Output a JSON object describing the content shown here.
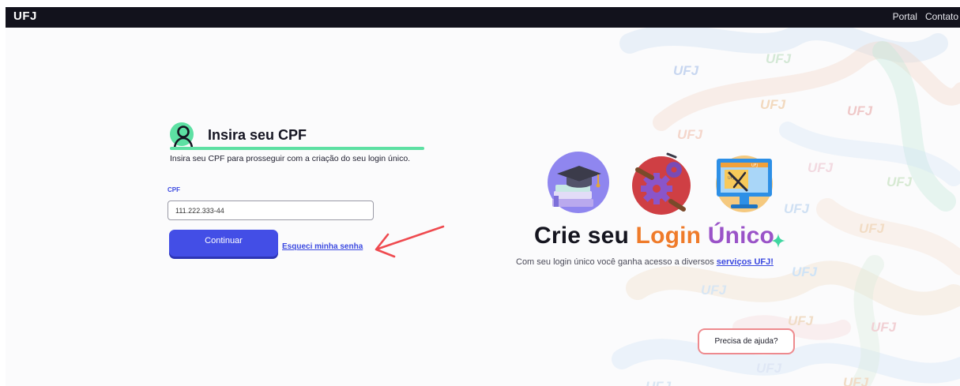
{
  "header": {
    "brand": "UFJ",
    "nav": [
      "Portal",
      "Contato"
    ]
  },
  "form": {
    "title": "Insira seu CPF",
    "subtitle": "Insira seu CPF para prosseguir com a criação do seu login único.",
    "cpf_label": "CPF",
    "cpf_value": "111.222.333-44",
    "continue_label": "Continuar",
    "forgot_label": "Esqueci minha senha"
  },
  "promo": {
    "title_part1": "Crie seu",
    "title_part2": "Login",
    "title_part3": "Único",
    "subtitle_prefix": "Com seu login único você ganha acesso a diversos",
    "subtitle_link": "serviços UFJ!",
    "illustration_labels": [
      "UFJ",
      "UFJ"
    ]
  },
  "help": {
    "label": "Precisa de ajuda?"
  },
  "watermark_text": "UFJ",
  "colors": {
    "topbar": "#12121c",
    "accent_blue": "#434ee6",
    "accent_green": "#5de0a3",
    "accent_orange": "#ef7b2a",
    "accent_purple": "#9a53c8",
    "help_border": "#ee8a8e",
    "annotation_arrow": "#ef4a4f"
  }
}
